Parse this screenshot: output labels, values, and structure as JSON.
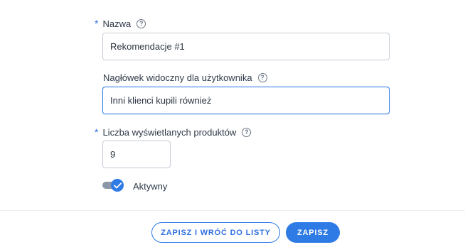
{
  "form": {
    "name_field": {
      "required_mark": "*",
      "label": "Nazwa",
      "help_icon": "?",
      "value": "Rekomendacje #1"
    },
    "header_field": {
      "label": "Nagłówek widoczny dla użytkownika",
      "help_icon": "?",
      "value": "Inni klienci kupili również"
    },
    "count_field": {
      "required_mark": "*",
      "label": "Liczba wyświetlanych produktów",
      "help_icon": "?",
      "value": "9"
    },
    "active_toggle": {
      "label": "Aktywny",
      "checked": true
    }
  },
  "footer": {
    "save_and_return_label": "ZAPISZ I WRÓĆ DO LISTY",
    "save_label": "ZAPISZ"
  },
  "colors": {
    "accent": "#2f7be5",
    "required": "#2f6fe0",
    "toggle_track": "#8b97a8"
  },
  "icons": {
    "help": "help-circle-icon",
    "toggle_check": "check-icon"
  }
}
